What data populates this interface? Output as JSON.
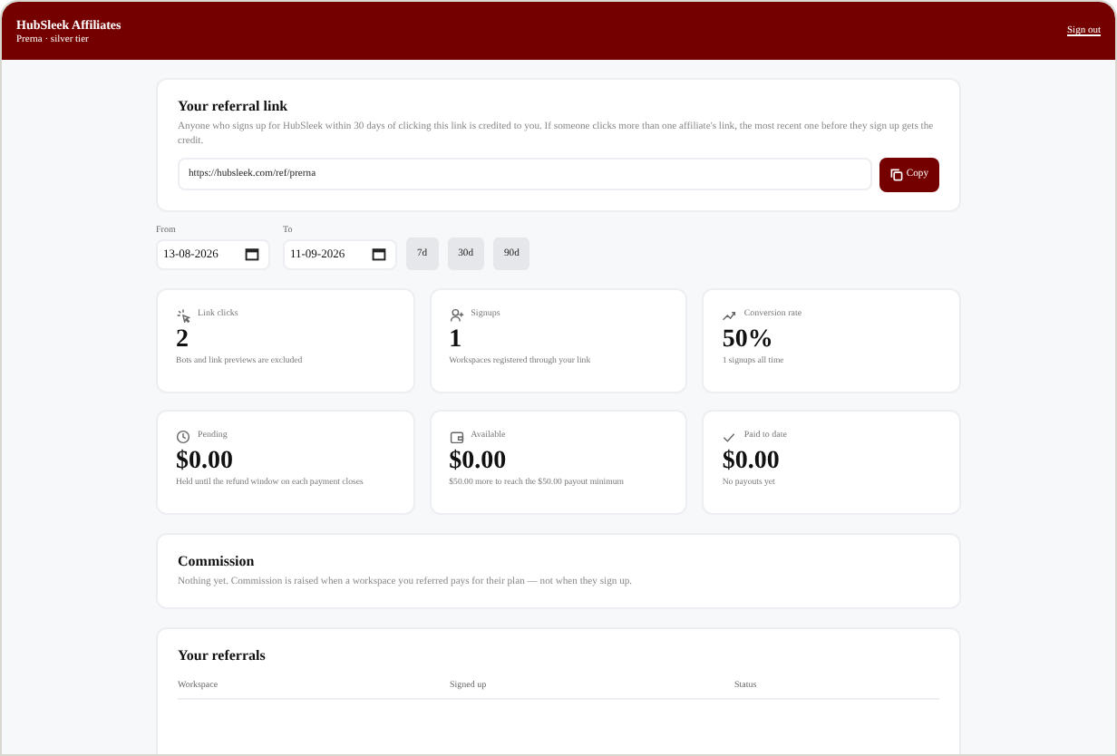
{
  "header": {
    "title": "HubSleek Affiliates",
    "subtitle": "Prerna · silver tier",
    "sign_out": "Sign out"
  },
  "referral_link": {
    "title": "Your referral link",
    "description": "Anyone who signs up for HubSleek within 30 days of clicking this link is credited to you. If someone clicks more than one affiliate's link, the most recent one before they sign up gets the credit.",
    "url": "https://hubsleek.com/ref/prerna",
    "copy_button": "Copy"
  },
  "date_range": {
    "from_label": "From",
    "from_value": "13-08-2026",
    "to_label": "To",
    "to_value": "11-09-2026",
    "presets": [
      "7d",
      "30d",
      "90d"
    ]
  },
  "stats": [
    {
      "label": "Link clicks",
      "value": "2",
      "note": "Bots and link previews are excluded"
    },
    {
      "label": "Signups",
      "value": "1",
      "note": "Workspaces registered through your link"
    },
    {
      "label": "Conversion rate",
      "value": "50%",
      "note": "1 signups all time"
    },
    {
      "label": "Pending",
      "value": "$0.00",
      "note": "Held until the refund window on each payment closes"
    },
    {
      "label": "Available",
      "value": "$0.00",
      "note": "$50.00 more to reach the $50.00 payout minimum"
    },
    {
      "label": "Paid to date",
      "value": "$0.00",
      "note": "No payouts yet"
    }
  ],
  "commission": {
    "title": "Commission",
    "text": "Nothing yet. Commission is raised when a workspace you referred pays for their plan — not when they sign up."
  },
  "referrals": {
    "title": "Your referrals",
    "columns": [
      "Workspace",
      "Signed up",
      "Status"
    ]
  }
}
